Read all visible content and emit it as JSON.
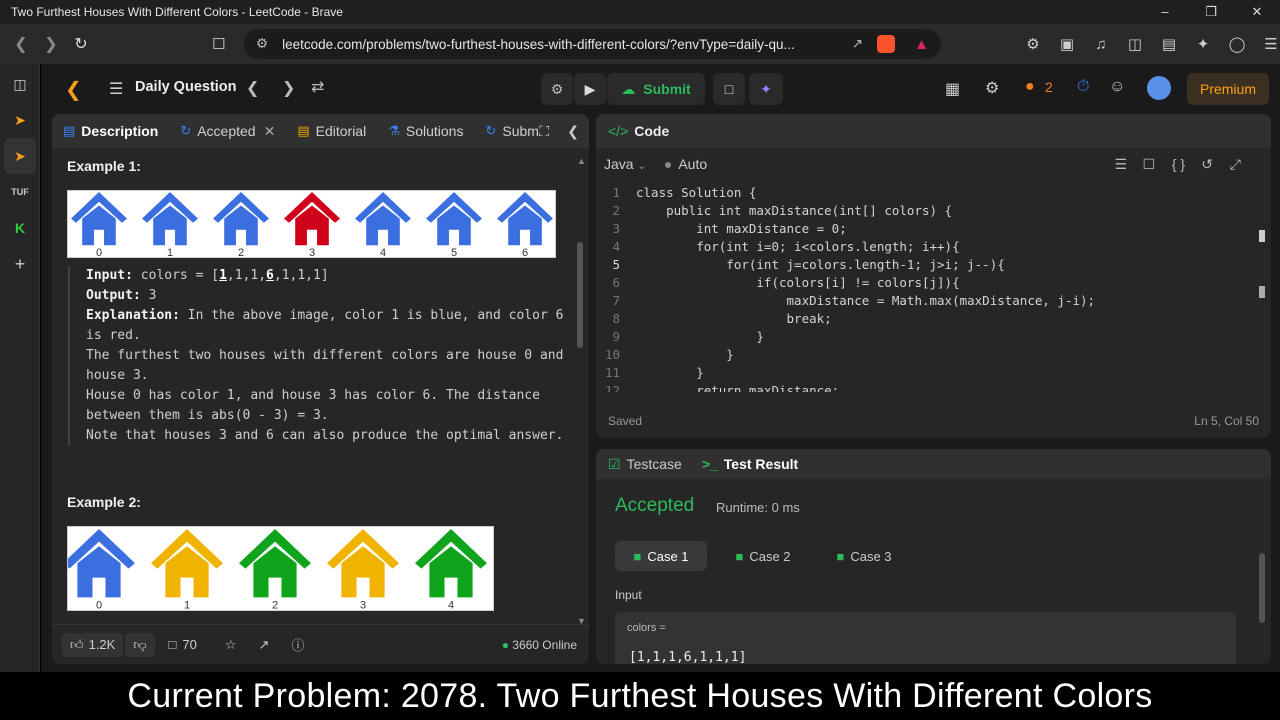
{
  "window": {
    "title": "Two Furthest Houses With Different Colors - LeetCode - Brave"
  },
  "browser": {
    "url": "leetcode.com/problems/two-furthest-houses-with-different-colors/?envType=daily-qu..."
  },
  "nav": {
    "daily_question": "Daily Question",
    "submit": "Submit",
    "streak": "2",
    "premium": "Premium"
  },
  "left_tabs": [
    {
      "label": "Description"
    },
    {
      "label": "Accepted"
    },
    {
      "label": "Editorial"
    },
    {
      "label": "Solutions"
    },
    {
      "label": "Subm"
    }
  ],
  "example1": {
    "heading": "Example 1:",
    "houses": [
      {
        "color": "#3b6fe0",
        "label": "0"
      },
      {
        "color": "#3b6fe0",
        "label": "1"
      },
      {
        "color": "#3b6fe0",
        "label": "2"
      },
      {
        "color": "#d0021b",
        "label": "3"
      },
      {
        "color": "#3b6fe0",
        "label": "4"
      },
      {
        "color": "#3b6fe0",
        "label": "5"
      },
      {
        "color": "#3b6fe0",
        "label": "6"
      }
    ],
    "input_label": "Input:",
    "input_pre": "colors = [",
    "input_hi1": "1",
    "input_mid": ",1,1,",
    "input_hi2": "6",
    "input_post": ",1,1,1]",
    "output_label": "Output:",
    "output_value": "3",
    "explanation_label": "Explanation:",
    "lines": [
      "In the above image, color 1 is blue, and color 6 is red.",
      "The furthest two houses with different colors are house 0 and house 3.",
      "House 0 has color 1, and house 3 has color 6. The distance between them is abs(0 - 3) = 3.",
      "Note that houses 3 and 6 can also produce the optimal answer."
    ]
  },
  "example2": {
    "heading": "Example 2:",
    "houses": [
      {
        "color": "#3b6fe0",
        "label": "0"
      },
      {
        "color": "#f0b400",
        "label": "1"
      },
      {
        "color": "#10a31c",
        "label": "2"
      },
      {
        "color": "#f0b400",
        "label": "3"
      },
      {
        "color": "#10a31c",
        "label": "4"
      }
    ]
  },
  "footer": {
    "likes": "1.2K",
    "comments": "70",
    "online": "3660 Online"
  },
  "code_panel": {
    "title": "Code",
    "language": "Java",
    "mode": "Auto",
    "status": "Saved",
    "cursor": "Ln 5, Col 50",
    "lines": [
      "class Solution {",
      "    public int maxDistance(int[] colors) {",
      "        int maxDistance = 0;",
      "        for(int i=0; i<colors.length; i++){",
      "            for(int j=colors.length-1; j>i; j--){",
      "                if(colors[i] != colors[j]){",
      "                    maxDistance = Math.max(maxDistance, j-i);",
      "                    break;",
      "                }",
      "            }",
      "        }",
      "        return maxDistance;"
    ]
  },
  "result_panel": {
    "tab_testcase": "Testcase",
    "tab_result": "Test Result",
    "status": "Accepted",
    "runtime": "Runtime: 0 ms",
    "cases": [
      "Case 1",
      "Case 2",
      "Case 3"
    ],
    "input_label": "Input",
    "var_label": "colors =",
    "var_value": "[1,1,1,6,1,1,1]"
  },
  "caption": "Current Problem: 2078. Two Furthest Houses With Different Colors"
}
